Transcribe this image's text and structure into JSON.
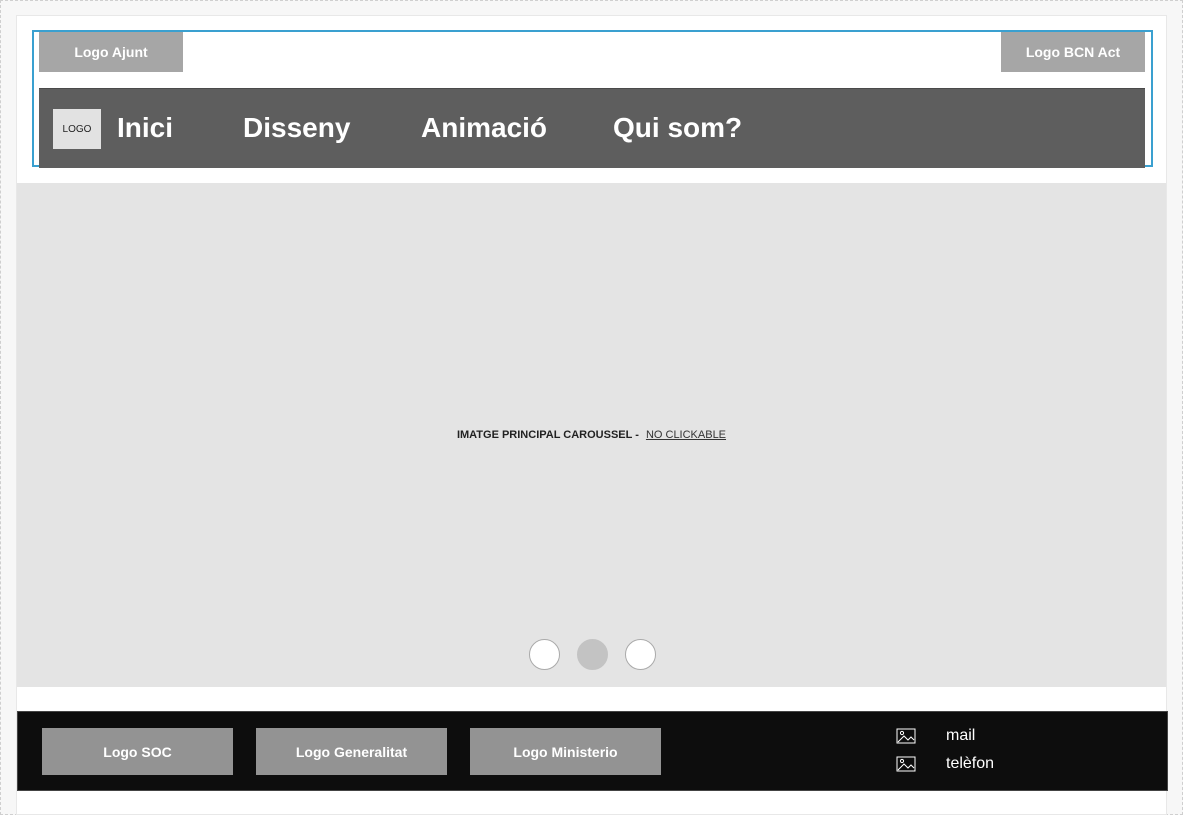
{
  "header": {
    "logo_left": "Logo Ajunt",
    "logo_right": "Logo BCN Act",
    "nav_logo": "LOGO",
    "nav": [
      "Inici",
      "Disseny",
      "Animació",
      "Qui som?"
    ]
  },
  "carousel": {
    "caption": "IMATGE PRINCIPAL CAROUSSEL -",
    "note": "NO CLICKABLE",
    "dots_count": 3,
    "active_dot": 2
  },
  "footer": {
    "logos": [
      "Logo SOC",
      "Logo Generalitat",
      "Logo Ministerio"
    ],
    "mail": "mail",
    "phone": "telèfon"
  },
  "colors": {
    "accent_border": "#3aa0d0",
    "navbar": "#5e5e5e",
    "footer": "#0d0d0d"
  }
}
